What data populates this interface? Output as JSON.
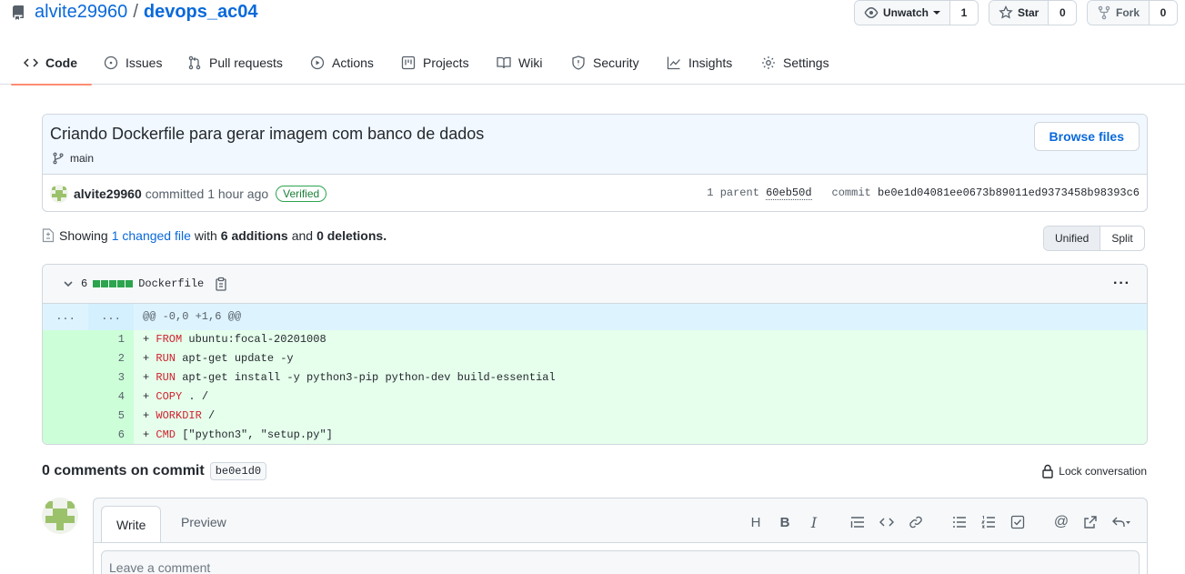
{
  "repo": {
    "owner": "alvite29960",
    "separator": "/",
    "name": "devops_ac04"
  },
  "social": {
    "watch_label": "Unwatch",
    "watch_count": "1",
    "star_label": "Star",
    "star_count": "0",
    "fork_label": "Fork",
    "fork_count": "0"
  },
  "tabs": [
    {
      "label": "Code",
      "icon": "code-icon",
      "active": true
    },
    {
      "label": "Issues",
      "icon": "issue-icon"
    },
    {
      "label": "Pull requests",
      "icon": "pull-request-icon"
    },
    {
      "label": "Actions",
      "icon": "play-icon"
    },
    {
      "label": "Projects",
      "icon": "project-icon"
    },
    {
      "label": "Wiki",
      "icon": "book-icon"
    },
    {
      "label": "Security",
      "icon": "shield-icon"
    },
    {
      "label": "Insights",
      "icon": "graph-icon"
    },
    {
      "label": "Settings",
      "icon": "gear-icon"
    }
  ],
  "commit": {
    "title": "Criando Dockerfile para gerar imagem com banco de dados",
    "branch": "main",
    "browse_label": "Browse files",
    "author": "alvite29960",
    "committed_text": "committed 1 hour ago",
    "verified_label": "Verified",
    "parent_label": "1 parent",
    "parent_sha": "60eb50d",
    "commit_label": "commit",
    "commit_sha": "be0e1d04081ee0673b89011ed9373458b98393c6"
  },
  "summary": {
    "showing": "Showing",
    "changed_link": "1 changed file",
    "with": "with",
    "additions": "6 additions",
    "and": "and",
    "deletions": "0 deletions",
    "period": "."
  },
  "view_toggle": {
    "unified": "Unified",
    "split": "Split",
    "selected": "Unified"
  },
  "file": {
    "changes": "6",
    "name": "Dockerfile",
    "hunk_left": "...",
    "hunk_right": "...",
    "hunk_header": "@@ -0,0 +1,6 @@",
    "lines": [
      {
        "num": "1",
        "plus": "+ ",
        "kw": "FROM",
        "rest": " ubuntu:focal-20201008"
      },
      {
        "num": "2",
        "plus": "+ ",
        "kw": "RUN",
        "rest": " apt-get update -y"
      },
      {
        "num": "3",
        "plus": "+ ",
        "kw": "RUN",
        "rest": " apt-get install -y python3-pip python-dev build-essential"
      },
      {
        "num": "4",
        "plus": "+ ",
        "kw": "COPY",
        "rest": " . /"
      },
      {
        "num": "5",
        "plus": "+ ",
        "kw": "WORKDIR",
        "rest": " /"
      },
      {
        "num": "6",
        "plus": "+ ",
        "kw": "CMD",
        "rest": " [\"python3\", \"setup.py\"]"
      }
    ]
  },
  "comments": {
    "title": "0 comments on commit",
    "sha": "be0e1d0",
    "lock_label": "Lock conversation",
    "write_tab": "Write",
    "preview_tab": "Preview",
    "placeholder": "Leave a comment"
  },
  "colors": {
    "accent": "#0969da",
    "added_bg": "#e6ffec",
    "added_gutter": "#ccffd8",
    "tab_underline": "#fd8c73",
    "verified": "#1a7f37"
  }
}
